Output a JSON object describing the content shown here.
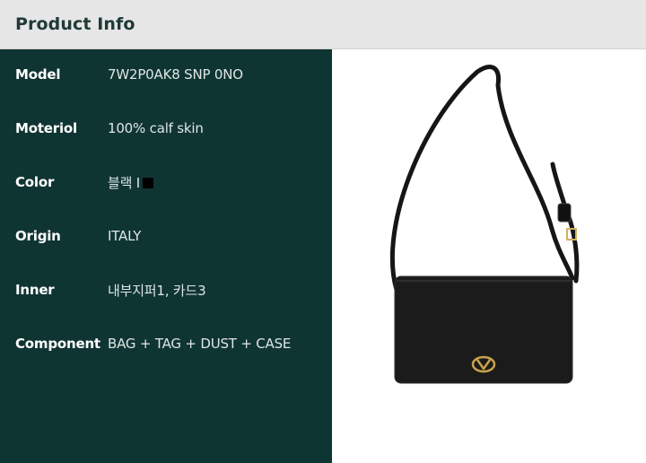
{
  "header": {
    "title": "Product Info"
  },
  "specs": [
    {
      "label": "Model",
      "value": "7W2P0AK8 SNP 0NO"
    },
    {
      "label": "Moteriol",
      "value": "100% calf skin"
    },
    {
      "label": "Color",
      "value": "블랙 I",
      "swatch": "#000000"
    },
    {
      "label": "Origin",
      "value": "ITALY"
    },
    {
      "label": "Inner",
      "value": "내부지퍼1, 카드3"
    },
    {
      "label": "Component",
      "value": "BAG + TAG + DUST + CASE"
    }
  ],
  "colors": {
    "header_bg": "#e6e6e6",
    "panel_bg": "#0f3533",
    "bag": "#1a1a1a",
    "hardware": "#c9a24a"
  },
  "product_image": {
    "icon": "shoulder-bag-image"
  }
}
